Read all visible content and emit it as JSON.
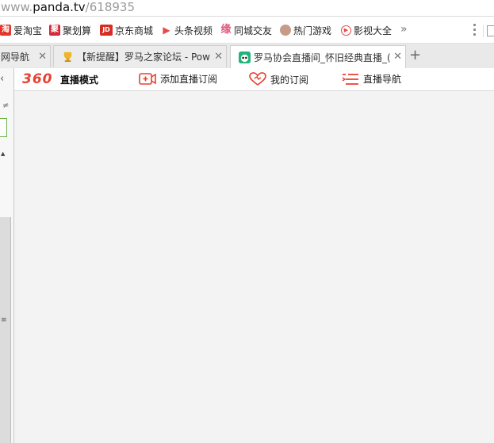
{
  "address_bar": {
    "url_prefix": "www.",
    "url_domain": "panda.tv",
    "url_path": "/618935"
  },
  "bookmarks": [
    {
      "label": "爱淘宝",
      "icon": "taobao-icon",
      "glyph": "淘",
      "color": "#e4352a"
    },
    {
      "label": "聚划算",
      "icon": "juhuasuan-icon",
      "glyph": "聚",
      "color": "#d6293a"
    },
    {
      "label": "京东商城",
      "icon": "jd-icon",
      "glyph": "JD",
      "color": "#d62d22"
    },
    {
      "label": "头条视频",
      "icon": "play-icon",
      "glyph": "▶",
      "color": "#e64a4a"
    },
    {
      "label": "同城交友",
      "icon": "heart-icon",
      "glyph": "缘",
      "color": "#e0587a"
    },
    {
      "label": "热门游戏",
      "icon": "avatar-icon",
      "glyph": "",
      "color": "#b08070"
    },
    {
      "label": "影视大全",
      "icon": "video-icon",
      "glyph": "▶",
      "color": "#e9473d"
    }
  ],
  "bookmarks_more": "»",
  "tabs": [
    {
      "title": "网导航",
      "active": false
    },
    {
      "title": "【新提醒】罗马之家论坛 - Pow",
      "active": false
    },
    {
      "title": "罗马协会直播间_怀旧经典直播_(",
      "active": true
    }
  ],
  "new_tab_label": "+",
  "toolbar360": {
    "logo": "360",
    "mode_label": "直播模式",
    "items": [
      {
        "label": "添加直播订阅",
        "icon": "add-video-icon"
      },
      {
        "label": "我的订阅",
        "icon": "heart-outline-icon"
      },
      {
        "label": "直播导航",
        "icon": "list-icon"
      }
    ],
    "accent": "#e84030"
  },
  "side_panel": {
    "collapse_glyph": "<",
    "close_glyph": "×"
  }
}
